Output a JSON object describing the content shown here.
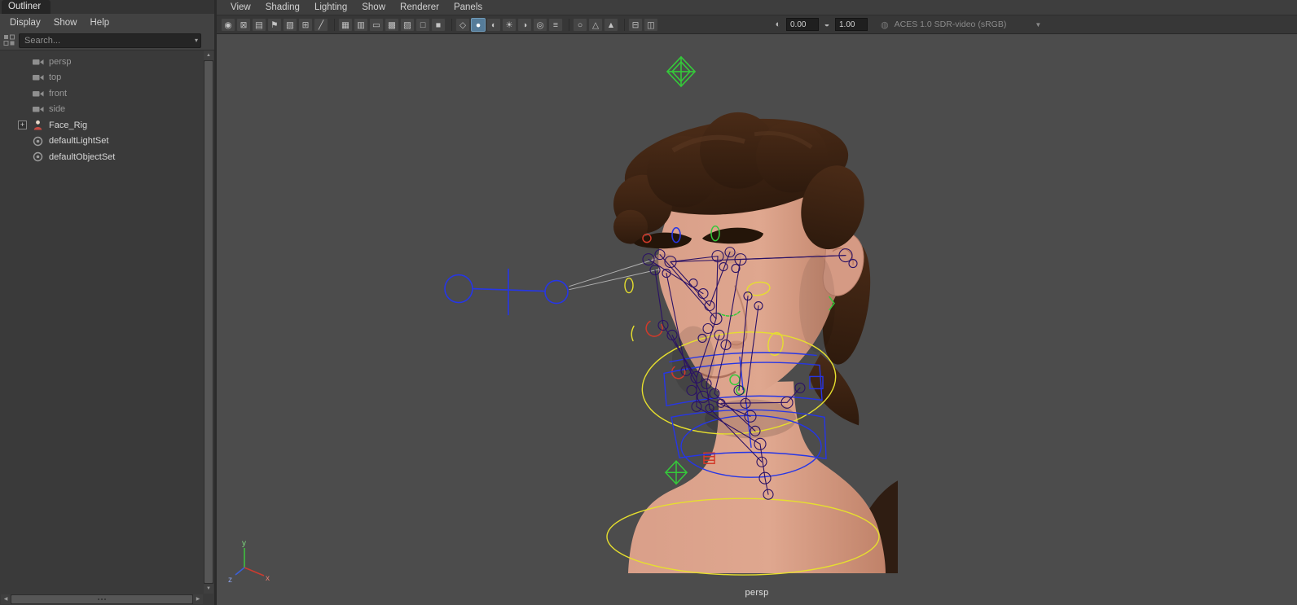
{
  "colors": {
    "viewport_bg": "#4c4c4c",
    "panel_bg": "#3a3a3a",
    "rig_blue": "#2636e6",
    "rig_yellow": "#e6df2e",
    "rig_green": "#35c93a",
    "rig_red": "#d23a2a",
    "rig_purple": "#2a1165",
    "skin": "#d89e88",
    "hair": "#3a2313"
  },
  "outliner": {
    "tab": "Outliner",
    "menus": [
      "Display",
      "Show",
      "Help"
    ],
    "search": {
      "placeholder": "Search...",
      "caret": "▾"
    },
    "items": [
      {
        "label": "persp",
        "type": "camera"
      },
      {
        "label": "top",
        "type": "camera"
      },
      {
        "label": "front",
        "type": "camera"
      },
      {
        "label": "side",
        "type": "camera"
      },
      {
        "label": "Face_Rig",
        "type": "rig",
        "expander": "+"
      },
      {
        "label": "defaultLightSet",
        "type": "set"
      },
      {
        "label": "defaultObjectSet",
        "type": "set"
      }
    ],
    "scroll": {
      "up": "▲",
      "down": "▼",
      "left": "◀",
      "right": "▶"
    }
  },
  "viewport": {
    "menus": [
      "View",
      "Shading",
      "Lighting",
      "Show",
      "Renderer",
      "Panels"
    ],
    "toolbar": {
      "icons": [
        {
          "name": "select-camera",
          "glyph": "◉"
        },
        {
          "name": "lock-camera",
          "glyph": "⊠"
        },
        {
          "name": "camera-attributes",
          "glyph": "▤"
        },
        {
          "name": "bookmark",
          "glyph": "⚑"
        },
        {
          "name": "image-plane",
          "glyph": "▧"
        },
        {
          "name": "two-d-pan-zoom",
          "glyph": "⊞"
        },
        {
          "name": "grease-pencil",
          "glyph": "╱"
        },
        {
          "sep": true
        },
        {
          "name": "grid",
          "glyph": "▦"
        },
        {
          "name": "film-gate",
          "glyph": "▥"
        },
        {
          "name": "resolution-gate",
          "glyph": "▭"
        },
        {
          "name": "gate-mask",
          "glyph": "▩"
        },
        {
          "name": "field-chart",
          "glyph": "▨"
        },
        {
          "name": "safe-action",
          "glyph": "□"
        },
        {
          "name": "safe-title",
          "glyph": "■"
        },
        {
          "sep": true
        },
        {
          "name": "wireframe",
          "glyph": "◇"
        },
        {
          "name": "smooth-shade",
          "glyph": "●",
          "active": true
        },
        {
          "name": "textured",
          "glyph": "◐"
        },
        {
          "name": "use-all-lights",
          "glyph": "☀"
        },
        {
          "name": "shadows",
          "glyph": "◑"
        },
        {
          "name": "screen-space-ao",
          "glyph": "◎"
        },
        {
          "name": "motion-blur",
          "glyph": "≡"
        },
        {
          "sep": true
        },
        {
          "name": "isolate-select",
          "glyph": "○"
        },
        {
          "name": "x-ray",
          "glyph": "△"
        },
        {
          "name": "x-ray-joints",
          "glyph": "▲"
        },
        {
          "sep": true
        },
        {
          "name": "tear-off-copy",
          "glyph": "⊟"
        },
        {
          "name": "pane-layout",
          "glyph": "◫"
        }
      ],
      "exposure_icon": "◐",
      "exposure": "0.00",
      "gamma_icon": "◒",
      "gamma": "1.00",
      "colorspace_icon": "◍",
      "colorspace": "ACES 1.0 SDR-video (sRGB)",
      "colorspace_caret": "▼"
    },
    "camera_label": "persp",
    "axis": {
      "x": "x",
      "y": "y",
      "z": "z"
    }
  }
}
